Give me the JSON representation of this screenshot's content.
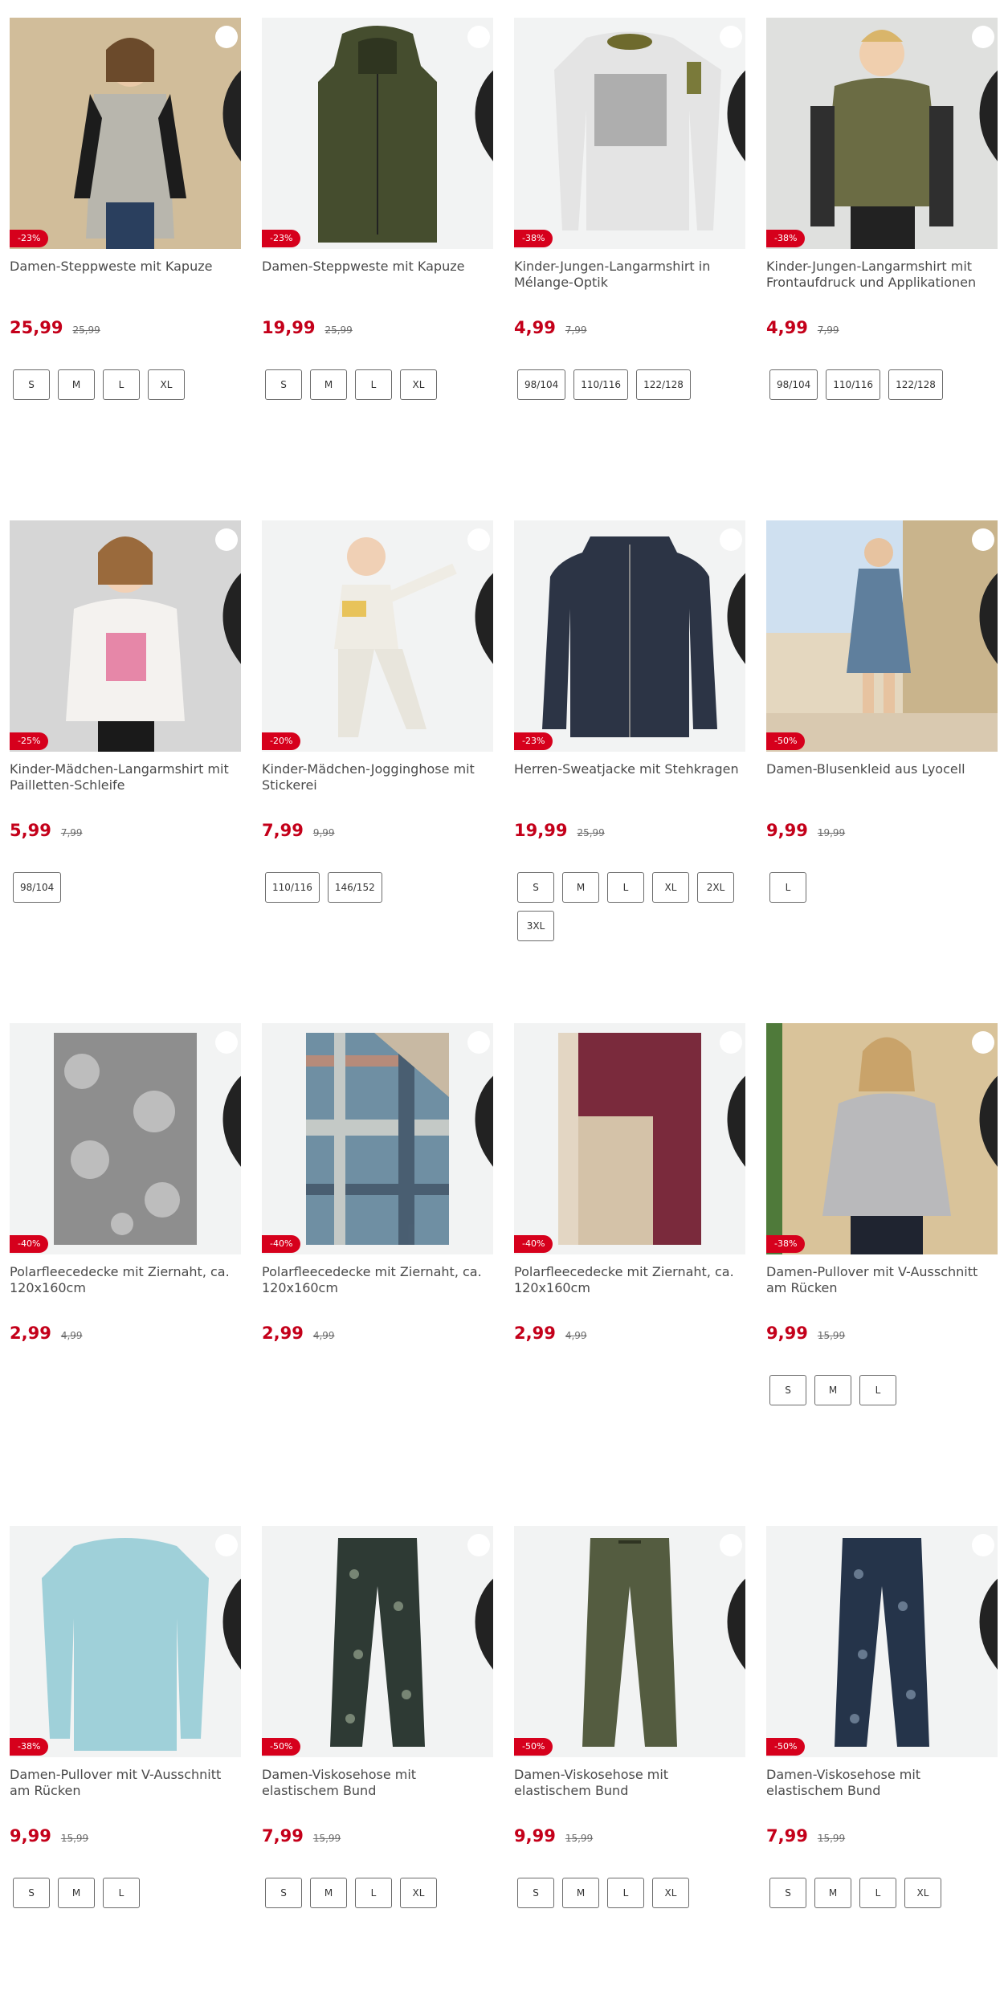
{
  "colors": {
    "discount_badge": "#d6001c",
    "price": "#c4001a",
    "image_bg": "#f2f3f3"
  },
  "products": [
    {
      "title": "Damen-Steppweste mit Kapuze",
      "discount": "-23%",
      "price": "25,99",
      "old_price": "25,99",
      "sizes": [
        "S",
        "M",
        "L",
        "XL"
      ],
      "image": "woman-quilted-vest-photo"
    },
    {
      "title": "Damen-Steppweste mit Kapuze",
      "discount": "-23%",
      "price": "19,99",
      "old_price": "25,99",
      "sizes": [
        "S",
        "M",
        "L",
        "XL"
      ],
      "image": "olive-quilted-vest-photo"
    },
    {
      "title": "Kinder-Jungen-Langarmshirt in Mélange-Optik",
      "discount": "-38%",
      "price": "4,99",
      "old_price": "7,99",
      "sizes": [
        "98/104",
        "110/116",
        "122/128"
      ],
      "image": "grey-longsleeve-print-photo"
    },
    {
      "title": "Kinder-Jungen-Langarmshirt mit Frontaufdruck und Applikationen",
      "discount": "-38%",
      "price": "4,99",
      "old_price": "7,99",
      "sizes": [
        "98/104",
        "110/116",
        "122/128"
      ],
      "image": "boy-olive-shirt-photo"
    },
    {
      "title": "Kinder-Mädchen-Langarmshirt mit Pailletten-Schleife",
      "discount": "-25%",
      "price": "5,99",
      "old_price": "7,99",
      "sizes": [
        "98/104"
      ],
      "image": "girl-white-shirt-photo"
    },
    {
      "title": "Kinder-Mädchen-Jogginghose mit Stickerei",
      "discount": "-20%",
      "price": "7,99",
      "old_price": "9,99",
      "sizes": [
        "110/116",
        "146/152"
      ],
      "image": "girl-joggers-photo"
    },
    {
      "title": "Herren-Sweatjacke mit Stehkragen",
      "discount": "-23%",
      "price": "19,99",
      "old_price": "25,99",
      "sizes": [
        "S",
        "M",
        "L",
        "XL",
        "2XL",
        "3XL"
      ],
      "image": "navy-sweat-jacket-photo"
    },
    {
      "title": "Damen-Blusenkleid aus Lyocell",
      "discount": "-50%",
      "price": "9,99",
      "old_price": "19,99",
      "sizes": [
        "L"
      ],
      "image": "woman-denim-dress-photo"
    },
    {
      "title": "Polarfleecedecke mit Ziernaht, ca. 120x160cm",
      "discount": "-40%",
      "price": "2,99",
      "old_price": "4,99",
      "sizes": [],
      "image": "grey-floral-blanket-photo"
    },
    {
      "title": "Polarfleecedecke mit Ziernaht, ca. 120x160cm",
      "discount": "-40%",
      "price": "2,99",
      "old_price": "4,99",
      "sizes": [],
      "image": "plaid-blanket-photo"
    },
    {
      "title": "Polarfleecedecke mit Ziernaht, ca. 120x160cm",
      "discount": "-40%",
      "price": "2,99",
      "old_price": "4,99",
      "sizes": [],
      "image": "burgundy-blanket-photo"
    },
    {
      "title": "Damen-Pullover mit V-Ausschnitt am Rücken",
      "discount": "-38%",
      "price": "9,99",
      "old_price": "15,99",
      "sizes": [
        "S",
        "M",
        "L"
      ],
      "image": "woman-grey-pullover-photo"
    },
    {
      "title": "Damen-Pullover mit V-Ausschnitt am Rücken",
      "discount": "-38%",
      "price": "9,99",
      "old_price": "15,99",
      "sizes": [
        "S",
        "M",
        "L"
      ],
      "image": "light-blue-pullover-photo"
    },
    {
      "title": "Damen-Viskosehose mit elastischem Bund",
      "discount": "-50%",
      "price": "7,99",
      "old_price": "15,99",
      "sizes": [
        "S",
        "M",
        "L",
        "XL"
      ],
      "image": "patterned-trousers-photo"
    },
    {
      "title": "Damen-Viskosehose mit elastischem Bund",
      "discount": "-50%",
      "price": "9,99",
      "old_price": "15,99",
      "sizes": [
        "S",
        "M",
        "L",
        "XL"
      ],
      "image": "olive-trousers-photo"
    },
    {
      "title": "Damen-Viskosehose mit elastischem Bund",
      "discount": "-50%",
      "price": "7,99",
      "old_price": "15,99",
      "sizes": [
        "S",
        "M",
        "L",
        "XL"
      ],
      "image": "navy-patterned-trousers-photo"
    }
  ]
}
